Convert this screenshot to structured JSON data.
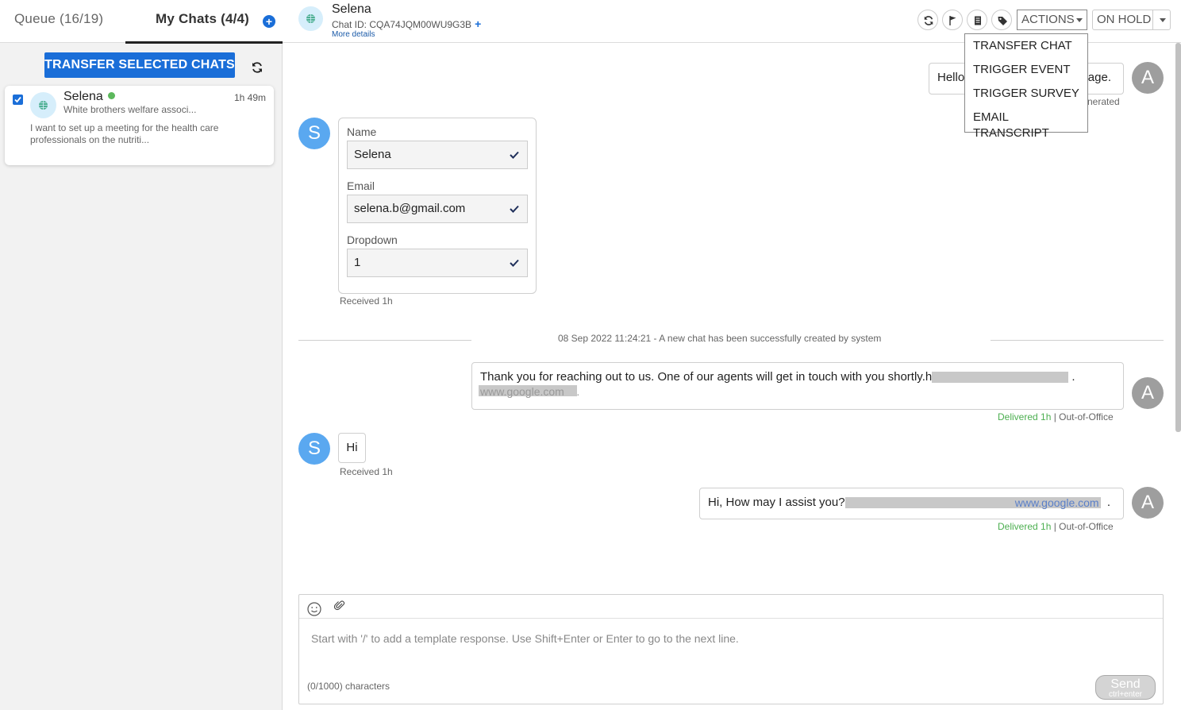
{
  "left_panel": {
    "tabs": {
      "queue": "Queue (16/19)",
      "my_chats": "My Chats (4/4)"
    },
    "transfer_button": "TRANSFER SELECTED CHATS",
    "chat_card": {
      "name": "Selena",
      "time": "1h 49m",
      "org": "White brothers welfare associ...",
      "message": "I want to set up a meeting for the health care professionals on the nutriti..."
    }
  },
  "header": {
    "name": "Selena",
    "chat_id": "Chat ID: CQA74JQM00WU9G3B",
    "add_symbol": "+",
    "more_details": "More details",
    "actions_label": "ACTIONS",
    "on_hold_label": "ON HOLD"
  },
  "actions_menu": [
    "TRANSFER CHAT",
    "TRIGGER EVENT",
    "TRIGGER SURVEY",
    "EMAIL TRANSCRIPT"
  ],
  "messages": {
    "top_partial": {
      "text_left": "Hello",
      "text_right": "age.",
      "meta": "nerated"
    },
    "form": {
      "fields": [
        {
          "label": "Name",
          "value": "Selena"
        },
        {
          "label": "Email",
          "value": "selena.b@gmail.com"
        },
        {
          "label": "Dropdown",
          "value": "1"
        }
      ],
      "meta": "Received 1h"
    },
    "system": "08 Sep 2022 11:24:21 - A new chat has been successfully created by system",
    "auto_reply": {
      "text": "Thank you for reaching out to us. One of our agents will get in touch with you shortly.h",
      "link_fragment": "www.google.com",
      "meta_delivered": "Delivered 1h",
      "meta_rest": " | Out-of-Office"
    },
    "customer_hi": {
      "text": "Hi",
      "meta": "Received 1h"
    },
    "agent_reply": {
      "text": "Hi, How may I assist you?",
      "link_fragment": "www.google.com",
      "meta_delivered": "Delivered 1h",
      "meta_rest": " | Out-of-Office"
    },
    "avatar_customer": "S",
    "avatar_agent": "A"
  },
  "composer": {
    "placeholder": "Start with '/' to add a template response. Use Shift+Enter or Enter to go to the next line.",
    "char_count": "(0/1000) characters",
    "send": "Send",
    "send_hint": "ctrl+enter"
  },
  "icons": {
    "add_chat": "plus-circle-icon",
    "refresh": "refresh-icon",
    "flag": "flag-icon",
    "notes": "notes-icon",
    "tag": "tag-icon",
    "globe": "globe-icon",
    "check": "check-icon",
    "emoji": "emoji-icon",
    "attach": "paperclip-icon"
  },
  "colors": {
    "primary": "#1a6ed8",
    "online": "#5cb85c",
    "delivered": "#4caf50",
    "customer_avatar": "#5aa8f0",
    "agent_avatar": "#9e9e9e"
  }
}
